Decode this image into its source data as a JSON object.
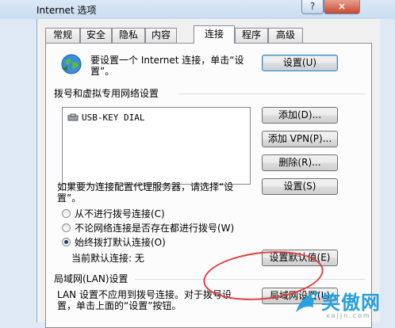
{
  "window": {
    "title": "Internet 选项",
    "close_label": "×",
    "help_label": "?"
  },
  "tabs": [
    {
      "label": "常规"
    },
    {
      "label": "安全"
    },
    {
      "label": "隐私"
    },
    {
      "label": "内容"
    },
    {
      "label": "连接",
      "active": true
    },
    {
      "label": "程序"
    },
    {
      "label": "高级"
    }
  ],
  "setup": {
    "text_line1": "要设置一个 Internet 连接，单击“设",
    "text_line2": "置”。",
    "button": "设置(U)"
  },
  "dialup": {
    "group_label": "拨号和虚拟专用网络设置",
    "items": [
      "USB-KEY DIAL"
    ],
    "add_button": "添加(D)...",
    "add_vpn_button": "添加 VPN(P)...",
    "remove_button": "删除(R)...",
    "proxy_text_line1": "如果要为连接配置代理服务器，请选择“设",
    "proxy_text_line2": "置”。",
    "settings_button": "设置(S)",
    "options": [
      {
        "label": "从不进行拨号连接(C)",
        "checked": false
      },
      {
        "label": "不论网络连接是否存在都进行拨号(W)",
        "checked": false
      },
      {
        "label": "始终拨打默认连接(O)",
        "checked": true
      }
    ],
    "current_default": "当前默认连接: 无",
    "set_default_button": "设置默认值(E)"
  },
  "lan": {
    "group_label": "局域网(LAN)设置",
    "text_line1": "LAN 设置不应用到拨号连接。对于拨号设",
    "text_line2": "置，单击上面的“设置”按钮。",
    "button": "局域网设置(L)"
  },
  "watermark": {
    "text": "笑傲网",
    "sub": "xajjn.com"
  },
  "colors": {
    "highlight_ellipse": "#e04040",
    "watermark": "#28a0dc"
  }
}
